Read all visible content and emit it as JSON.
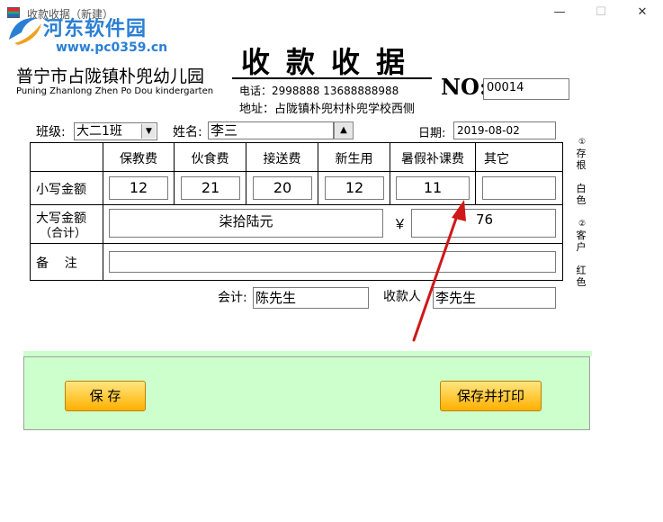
{
  "window": {
    "title": "收款收据（新建）",
    "minimize_glyph": "—",
    "maximize_glyph": "☐",
    "close_glyph": "✕"
  },
  "watermark": {
    "name": "河东软件园",
    "url": "www.pc0359.cn"
  },
  "header": {
    "school_cn": "普宁市占陇镇朴兜幼儿园",
    "school_en": "Puning Zhanlong Zhen Po Dou kindergarten",
    "receipt_title": "收款收据",
    "phone": "电话：2998888   13688888988",
    "address": "地址：占陇镇朴兜村朴兜学校西侧",
    "no_label": "NO:",
    "no_value": "00014"
  },
  "form": {
    "class_label": "班级:",
    "class_value": "大二1班",
    "name_label": "姓名:",
    "name_value": "李三",
    "date_label": "日期:",
    "date_value": "2019-08-02"
  },
  "table": {
    "columns": [
      "保教费",
      "伙食费",
      "接送费",
      "新生用",
      "暑假补课费",
      "其它"
    ],
    "small_amount_label": "小写金额",
    "small_amounts": [
      "12",
      "21",
      "20",
      "12",
      "11",
      ""
    ],
    "big_amount_label": "大写金额",
    "big_amount_sub": "（合计）",
    "big_amount_value": "柒拾陆元",
    "yen_symbol": "￥",
    "total_value": "76",
    "remark_label": "备    注",
    "remark_value": ""
  },
  "side_notes": {
    "stub_mark": "①",
    "stub": "存根",
    "stub_color": "白色",
    "customer_mark": "②",
    "customer": "客户",
    "customer_color": "红色"
  },
  "signatures": {
    "accountant_label": "会计:",
    "accountant_value": "陈先生",
    "payee_label": "收款人",
    "payee_value": "李先生"
  },
  "buttons": {
    "save": "保 存",
    "save_print": "保存并打印"
  },
  "colors": {
    "panel_green": "#ccffcc",
    "button_orange": "#ffb000",
    "arrow_red": "#d01818",
    "watermark_blue": "#2a7fd4"
  }
}
